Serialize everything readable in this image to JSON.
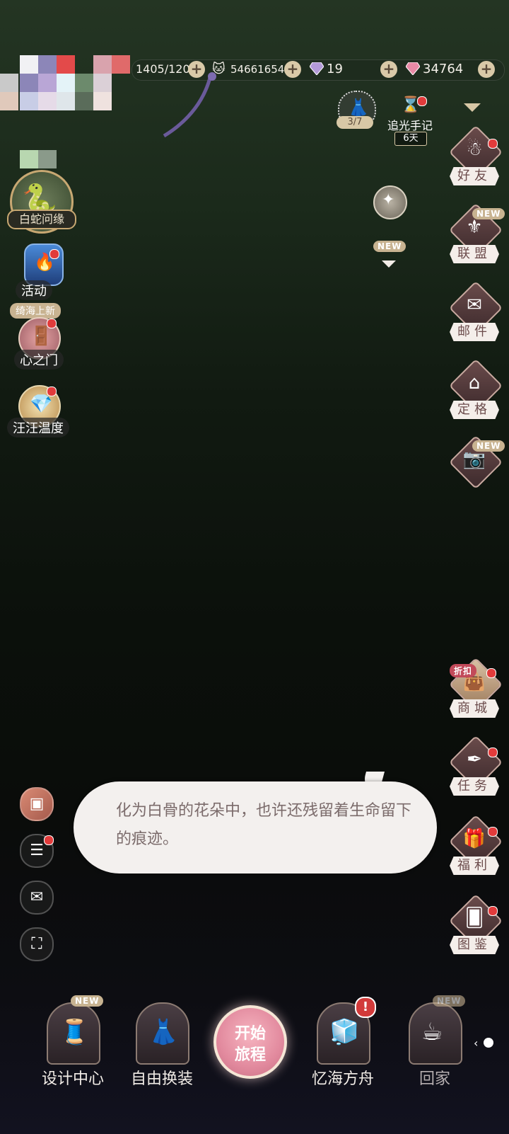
{
  "resources": {
    "stamina": "1405/120",
    "coins": "54661654",
    "purple_gems": "19",
    "pink_gems": "34764"
  },
  "top_center": {
    "progress_badge": "3/7",
    "journal_label": "追光手记",
    "journal_days": "6天"
  },
  "left_menu": {
    "event_banner": "白蛇问缘",
    "activity_label": "活动",
    "heart_gate_tag": "绮海上新",
    "heart_gate_label": "心之门",
    "wangwang_label": "汪汪温度"
  },
  "center_new_tag": "NEW",
  "right_menu": [
    {
      "label": "好友",
      "icon": "ghost-icon"
    },
    {
      "label": "联盟",
      "icon": "wings-icon",
      "tag": "NEW"
    },
    {
      "label": "邮件",
      "icon": "mail-icon"
    },
    {
      "label": "定格",
      "icon": "house-icon"
    },
    {
      "label": "",
      "icon": "camera-icon",
      "tag": "NEW"
    },
    {
      "label": "商城",
      "icon": "bag-icon",
      "tag": "折扣"
    },
    {
      "label": "任务",
      "icon": "quill-icon"
    },
    {
      "label": "福利",
      "icon": "gift-icon"
    },
    {
      "label": "图鉴",
      "icon": "card-icon"
    }
  ],
  "dialogue": "化为白骨的花朵中，也许还残留着生命留下的痕迹。",
  "bottom_nav": {
    "design_center": "设计中心",
    "design_center_tag": "NEW",
    "free_dress": "自由换装",
    "start_line1": "开始",
    "start_line2": "旅程",
    "ark": "忆海方舟",
    "home": "回家",
    "home_tag": "NEW"
  },
  "colors": {
    "accent_red": "#e23b3b",
    "cream": "#f4eeea",
    "rose": "#6b4b4b"
  }
}
